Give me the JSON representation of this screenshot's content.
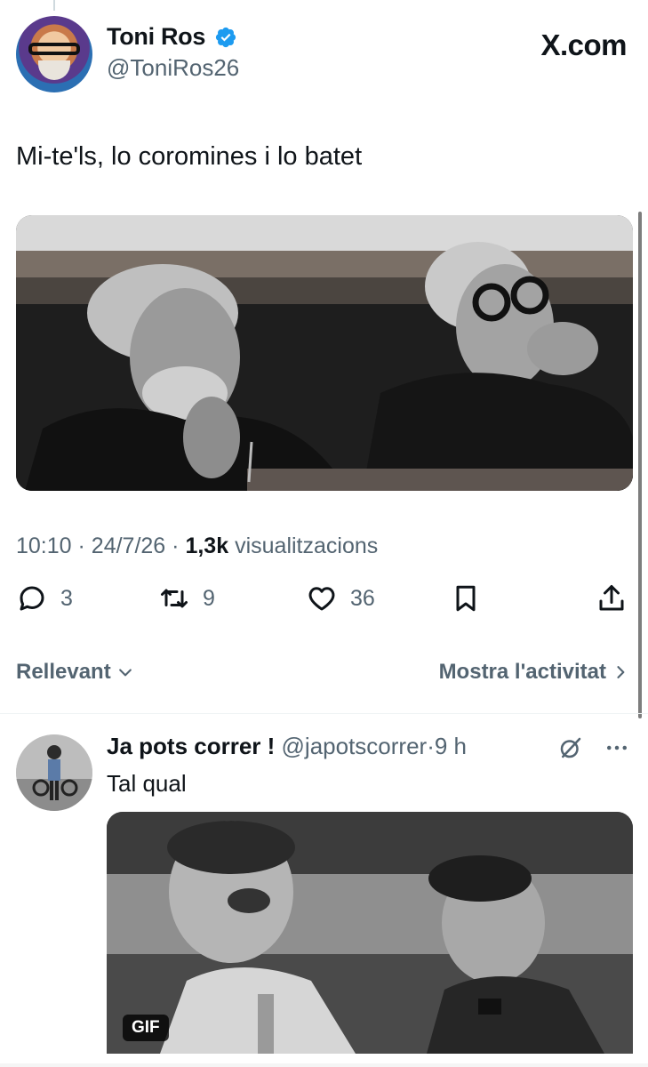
{
  "author": {
    "name": "Toni Ros",
    "handle": "@ToniRos26"
  },
  "site": "X.com",
  "tweet": {
    "text": "Mi-te'ls, lo coromines i lo batet",
    "time": "10:10",
    "date": "24/7/26",
    "views_count": "1,3k",
    "views_label": "visualitzacions",
    "separator": "·"
  },
  "actions": {
    "replies": "3",
    "retweets": "9",
    "likes": "36"
  },
  "sort": {
    "left_label": "Rellevant",
    "right_label": "Mostra l'activitat"
  },
  "reply": {
    "name": "Ja pots correr !",
    "handle": "@japotscorrer",
    "separator": "·",
    "age": "9 h",
    "text": "Tal qual",
    "media_badge": "GIF"
  },
  "colors": {
    "verified": "#1d9bf0",
    "muted": "#536471",
    "text": "#0f1419"
  },
  "icons": {
    "verified": "verified-badge-icon",
    "reply": "reply-icon",
    "retweet": "retweet-icon",
    "like": "heart-icon",
    "bookmark": "bookmark-icon",
    "share": "share-icon",
    "chevron": "chevron-down-icon",
    "chevron_right": "chevron-right-icon",
    "grok": "grok-icon",
    "more": "more-icon"
  }
}
